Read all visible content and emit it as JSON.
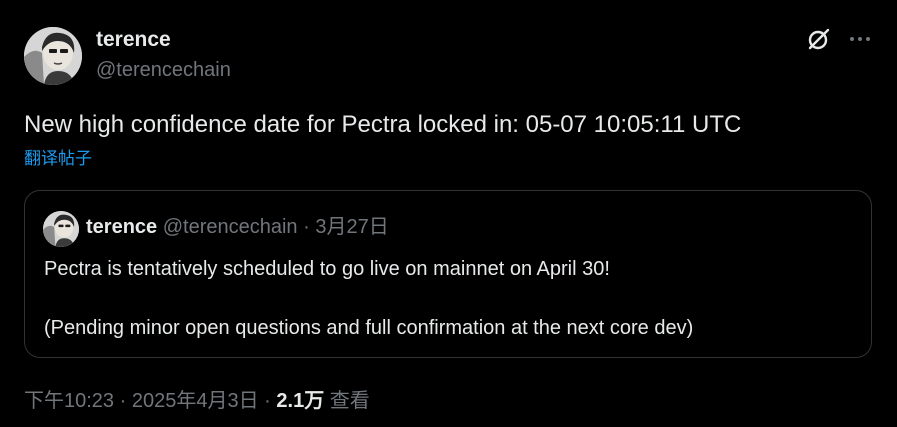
{
  "author": {
    "display_name": "terence",
    "handle": "@terencechain"
  },
  "header_icons": {
    "grok": "grok-icon",
    "more": "more-icon"
  },
  "tweet": {
    "text": "New high confidence date for Pectra locked in: 05-07 10:05:11 UTC",
    "translate_label": "翻译帖子"
  },
  "quoted_tweet": {
    "display_name": "terence",
    "handle": "@terencechain",
    "separator": "·",
    "date": "3月27日",
    "line1": "Pectra is tentatively scheduled to go live on mainnet on April 30!",
    "line2": "(Pending minor open questions and full confirmation at the next core dev)"
  },
  "meta": {
    "time": "下午10:23",
    "separator": "·",
    "date": "2025年4月3日",
    "views_count": "2.1万",
    "views_label": "查看"
  },
  "colors": {
    "background": "#000000",
    "text": "#e7e9ea",
    "muted": "#71767b",
    "link": "#1d9bf0",
    "border": "#2f3336"
  }
}
